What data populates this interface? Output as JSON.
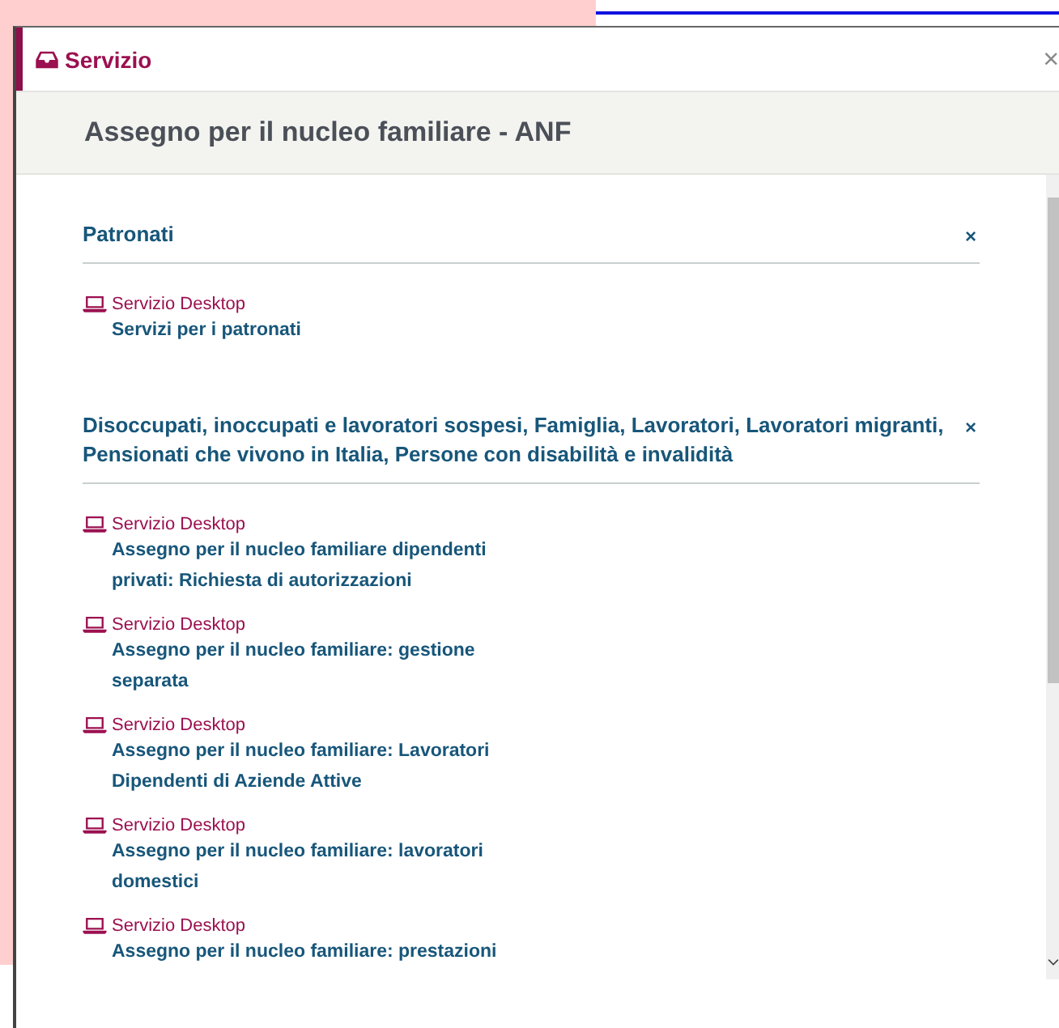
{
  "header": {
    "title": "Servizio",
    "close": "×"
  },
  "service_title": "Assegno per il nucleo familiare - ANF",
  "sections": [
    {
      "title": "Patronati",
      "remove": "×",
      "items": [
        {
          "category": "Servizio Desktop",
          "name": "Servizi per i patronati"
        }
      ]
    },
    {
      "title": "Disoccupati, inoccupati e lavoratori sospesi, Famiglia, Lavoratori, Lavoratori migranti, Pensionati che vivono in Italia, Persone con disabilità e invalidità",
      "remove": "×",
      "items": [
        {
          "category": "Servizio Desktop",
          "name": "Assegno per il nucleo familiare dipendenti privati: Richiesta di autorizzazioni"
        },
        {
          "category": "Servizio Desktop",
          "name": "Assegno per il nucleo familiare: gestione separata"
        },
        {
          "category": "Servizio Desktop",
          "name": "Assegno per il nucleo familiare: Lavoratori Dipendenti di Aziende Attive"
        },
        {
          "category": "Servizio Desktop",
          "name": "Assegno per il nucleo familiare: lavoratori domestici"
        },
        {
          "category": "Servizio Desktop",
          "name": "Assegno per il nucleo familiare: prestazioni"
        }
      ]
    }
  ]
}
